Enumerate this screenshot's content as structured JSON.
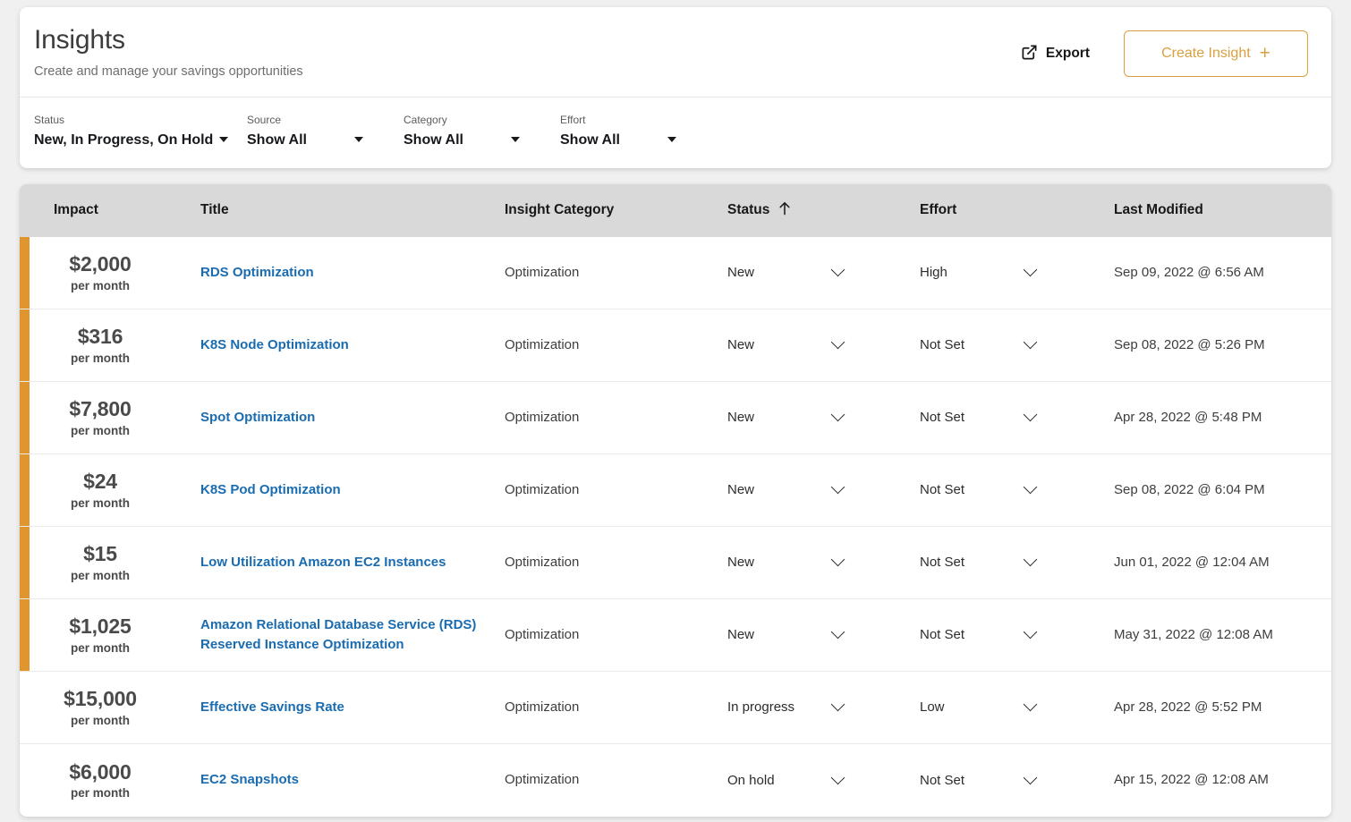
{
  "header": {
    "title": "Insights",
    "subtitle": "Create and manage your savings opportunities",
    "export_label": "Export",
    "export_icon": "external-link-icon",
    "create_label": "Create Insight",
    "create_plus": "+",
    "accent_color": "#d9a040"
  },
  "filters": [
    {
      "label": "Status",
      "value": "New, In Progress, On Hold"
    },
    {
      "label": "Source",
      "value": "Show All"
    },
    {
      "label": "Category",
      "value": "Show All"
    },
    {
      "label": "Effort",
      "value": "Show All"
    }
  ],
  "table": {
    "columns": {
      "impact": "Impact",
      "title": "Title",
      "category": "Insight Category",
      "status": "Status",
      "effort": "Effort",
      "modified": "Last Modified"
    },
    "sort": {
      "column": "Status",
      "direction": "asc",
      "icon": "sort-arrow-up-icon"
    },
    "header_bg": "#d9d9d9",
    "accent_color": "#e0952f",
    "link_color": "#1a6cb0",
    "period_label": "per month",
    "rows": [
      {
        "impact": "$2,000",
        "period": "per month",
        "accent": true,
        "title": "RDS Optimization",
        "category": "Optimization",
        "status": "New",
        "effort": "High",
        "modified": "Sep 09, 2022 @ 6:56 AM"
      },
      {
        "impact": "$316",
        "period": "per month",
        "accent": true,
        "title": "K8S Node Optimization",
        "category": "Optimization",
        "status": "New",
        "effort": "Not Set",
        "modified": "Sep 08, 2022 @ 5:26 PM"
      },
      {
        "impact": "$7,800",
        "period": "per month",
        "accent": true,
        "title": "Spot Optimization",
        "category": "Optimization",
        "status": "New",
        "effort": "Not Set",
        "modified": "Apr 28, 2022 @ 5:48 PM"
      },
      {
        "impact": "$24",
        "period": "per month",
        "accent": true,
        "title": "K8S Pod Optimization",
        "category": "Optimization",
        "status": "New",
        "effort": "Not Set",
        "modified": "Sep 08, 2022 @ 6:04 PM"
      },
      {
        "impact": "$15",
        "period": "per month",
        "accent": true,
        "title": "Low Utilization Amazon EC2 Instances",
        "category": "Optimization",
        "status": "New",
        "effort": "Not Set",
        "modified": "Jun 01, 2022 @ 12:04 AM"
      },
      {
        "impact": "$1,025",
        "period": "per month",
        "accent": true,
        "title": "Amazon Relational Database Service (RDS) Reserved Instance Optimization",
        "category": "Optimization",
        "status": "New",
        "effort": "Not Set",
        "modified": "May 31, 2022 @ 12:08 AM"
      },
      {
        "impact": "$15,000",
        "period": "per month",
        "accent": false,
        "title": "Effective Savings Rate",
        "category": "Optimization",
        "status": "In progress",
        "effort": "Low",
        "modified": "Apr 28, 2022 @ 5:52 PM"
      },
      {
        "impact": "$6,000",
        "period": "per month",
        "accent": false,
        "title": "EC2 Snapshots",
        "category": "Optimization",
        "status": "On hold",
        "effort": "Not Set",
        "modified": "Apr 15, 2022 @ 12:08 AM"
      }
    ]
  }
}
